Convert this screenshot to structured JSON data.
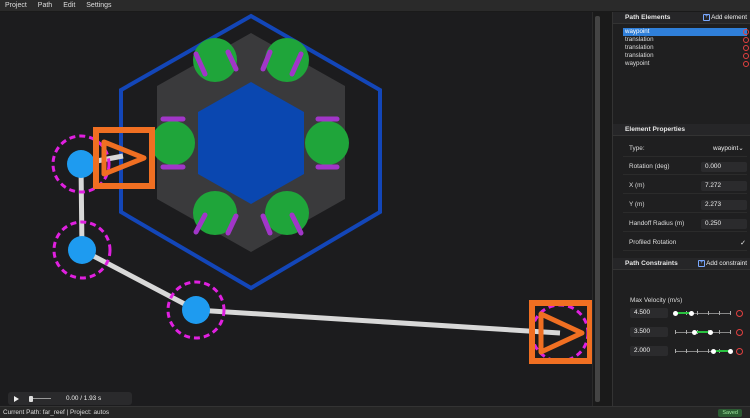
{
  "menu": [
    "Project",
    "Path",
    "Edit",
    "Settings"
  ],
  "path_elements": {
    "title": "Path Elements",
    "add_label": "Add element",
    "items": [
      "waypoint",
      "translation",
      "translation",
      "translation",
      "waypoint"
    ],
    "selected_index": 0
  },
  "element_properties": {
    "title": "Element Properties",
    "type_label": "Type:",
    "type_value": "waypoint",
    "rotation_label": "Rotation (deg)",
    "rotation_value": "0.000",
    "x_label": "X (m)",
    "x_value": "7.272",
    "y_label": "Y (m)",
    "y_value": "2.273",
    "handoff_label": "Handoff Radius (m)",
    "handoff_value": "0.250",
    "profiled_label": "Profiled Rotation",
    "profiled_checked": true
  },
  "path_constraints": {
    "title": "Path Constraints",
    "add_label": "Add constraint",
    "constraint_name": "Max Velocity (m/s)",
    "rows": [
      {
        "value": "4.500",
        "range_start": 0.0,
        "range_end": 0.3
      },
      {
        "value": "3.500",
        "range_start": 0.35,
        "range_end": 0.65
      },
      {
        "value": "2.000",
        "range_start": 0.7,
        "range_end": 1.0
      }
    ]
  },
  "player": {
    "time_text": "0.00 / 1.93 s",
    "progress": 0.0
  },
  "status": {
    "text": "Current Path: far_reef | Project: autos",
    "saved": "Saved"
  },
  "colors": {
    "canvas_bg": "#1c1c1e",
    "path_line": "#d8d8d8",
    "waypoint": "#1e9bf0",
    "handoff_ring": "#e020e0",
    "robot_box": "#f06f22",
    "reef_outline": "#1346b8",
    "reef_hex": "#3a3a3c",
    "reef_center": "#0a47b0",
    "reef_green": "#1fa53a",
    "reef_purple": "#a136c8",
    "accent": "#2f7fd9"
  }
}
